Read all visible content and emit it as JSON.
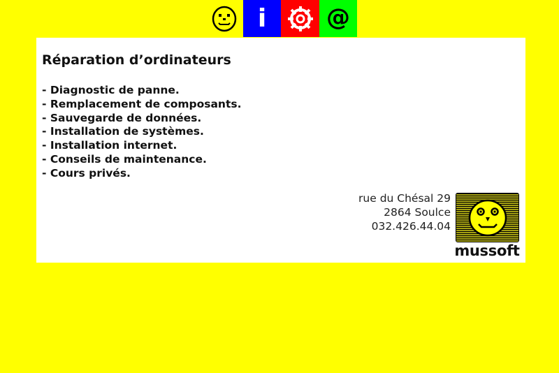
{
  "nav": {
    "items": [
      {
        "name": "home",
        "icon": "smiley-icon",
        "color": "#ffff00"
      },
      {
        "name": "info",
        "icon": "info-icon",
        "glyph": "i",
        "color": "#0000ff"
      },
      {
        "name": "settings",
        "icon": "gear-icon",
        "color": "#ff0000"
      },
      {
        "name": "contact",
        "icon": "at-icon",
        "glyph": "@",
        "color": "#00ff00"
      }
    ]
  },
  "content": {
    "title": "Réparation d’ordinateurs",
    "services": [
      "- Diagnostic de panne.",
      "- Remplacement de composants.",
      "- Sauvegarde de données.",
      "- Installation de systèmes.",
      "- Installation internet.",
      "- Conseils de maintenance.",
      "- Cours privés."
    ]
  },
  "address": {
    "street": "rue du Chésal 29",
    "city": "2864 Soulce",
    "phone": "032.426.44.04"
  },
  "brand": {
    "name": "mussoft",
    "logo_icon": "smiley-logo-icon"
  },
  "colors": {
    "background": "#ffff00",
    "panel": "#ffffff",
    "info": "#0000ff",
    "settings": "#ff0000",
    "contact": "#00ff00",
    "logo_bg": "#a6a213"
  }
}
